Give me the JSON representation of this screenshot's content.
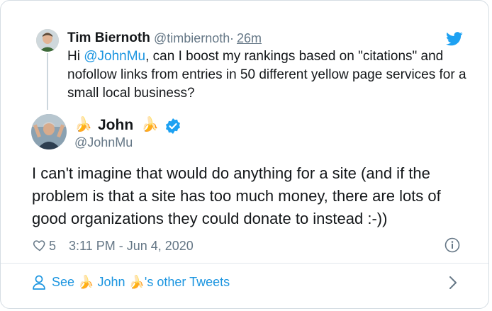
{
  "reply": {
    "author_name": "Tim Biernoth",
    "author_handle": "@timbiernoth",
    "separator": "·",
    "time_ago": "26m",
    "text_mention": "@JohnMu",
    "text_before": "Hi ",
    "text_after": ", can I boost my rankings based on \"citations\" and nofollow links from entries in 50 different yellow page services for a small local business?"
  },
  "tweet": {
    "author_emoji_left": "🍌",
    "author_name": "John",
    "author_emoji_right": "🍌",
    "author_handle": "@JohnMu",
    "text": "I can't imagine that would do anything for a site (and if the problem is that a site has too much money, there are lots of good organizations they could donate to instead :-))",
    "like_count": "5",
    "timestamp": "3:11 PM - Jun 4, 2020"
  },
  "footer": {
    "cta_prefix": "See ",
    "cta_emoji_left": "🍌",
    "cta_name": " John ",
    "cta_emoji_right": "🍌",
    "cta_suffix": "'s other Tweets"
  },
  "colors": {
    "twitter_blue": "#1da1f2",
    "link_blue": "#1b95e0",
    "text": "#14171a",
    "muted": "#657786",
    "border": "#d5dde3"
  },
  "icons": [
    "twitter-bird-icon",
    "verified-badge-icon",
    "heart-icon",
    "info-icon",
    "user-icon",
    "chevron-right-icon"
  ]
}
